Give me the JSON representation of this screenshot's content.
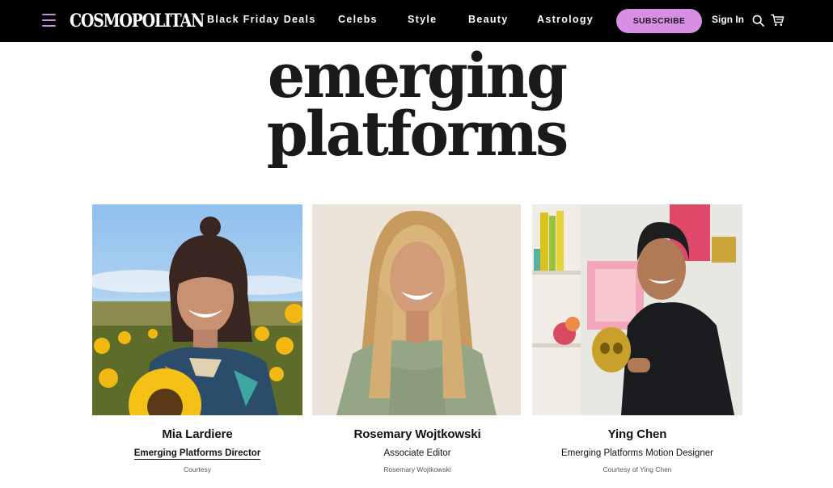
{
  "header": {
    "logo": "COSMOPOLITAN",
    "nav": [
      "Black Friday Deals",
      "Celebs",
      "Style",
      "Beauty",
      "Astrology"
    ],
    "subscribe_label": "SUBSCRIBE",
    "signin_label": "Sign In"
  },
  "heading": {
    "line1": "emerging",
    "line2": "platforms"
  },
  "colors": {
    "header_bg": "#000000",
    "accent": "#d98ee6",
    "menu_icon": "#c98ae0"
  },
  "people": [
    {
      "name": "Mia Lardiere",
      "title": "Emerging Platforms Director",
      "title_is_link": true,
      "credit": "Courtesy"
    },
    {
      "name": "Rosemary Wojtkowski",
      "title": "Associate Editor",
      "title_is_link": false,
      "credit": "Rosemary Wojtkowski"
    },
    {
      "name": "Ying Chen",
      "title": "Emerging Platforms Motion Designer",
      "title_is_link": false,
      "credit": "Courtesy of Ying Chen"
    }
  ]
}
